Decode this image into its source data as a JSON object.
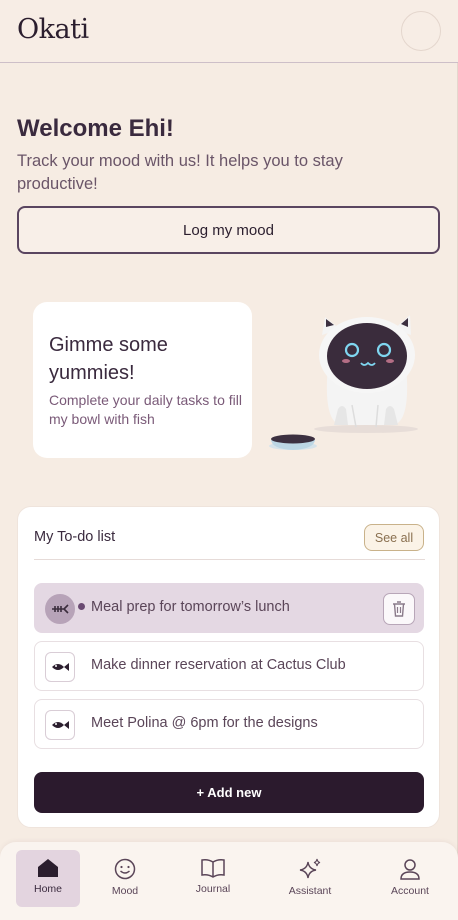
{
  "app": {
    "logo": "Okati"
  },
  "welcome": {
    "title": "Welcome Ehi!",
    "subtitle": "Track your mood with us! It helps you to stay productive!",
    "log_button": "Log my mood"
  },
  "promo": {
    "title": "Gimme some yummies!",
    "text": "Complete your daily tasks to fill my bowl with fish"
  },
  "todo": {
    "title": "My To-do list",
    "see_all": "See all",
    "items": [
      {
        "label": "Meal prep for tomorrow’s lunch",
        "icon": "fish-bone-icon",
        "active": true
      },
      {
        "label": "Make dinner reservation at Cactus Club",
        "icon": "fish-icon",
        "active": false
      },
      {
        "label": "Meet Polina @ 6pm for the designs",
        "icon": "fish-icon",
        "active": false
      }
    ],
    "add_button": "+ Add new"
  },
  "nav": {
    "items": [
      {
        "label": "Home",
        "icon": "home-icon",
        "active": true
      },
      {
        "label": "Mood",
        "icon": "smiley-icon",
        "active": false
      },
      {
        "label": "Journal",
        "icon": "book-icon",
        "active": false
      },
      {
        "label": "Assistant",
        "icon": "sparkle-icon",
        "active": false
      },
      {
        "label": "Account",
        "icon": "user-icon",
        "active": false
      }
    ]
  },
  "colors": {
    "background": "#f6ece3",
    "primary_dark": "#2b1a2d",
    "accent_lilac": "#e4d8e3",
    "card": "#ffffff"
  }
}
